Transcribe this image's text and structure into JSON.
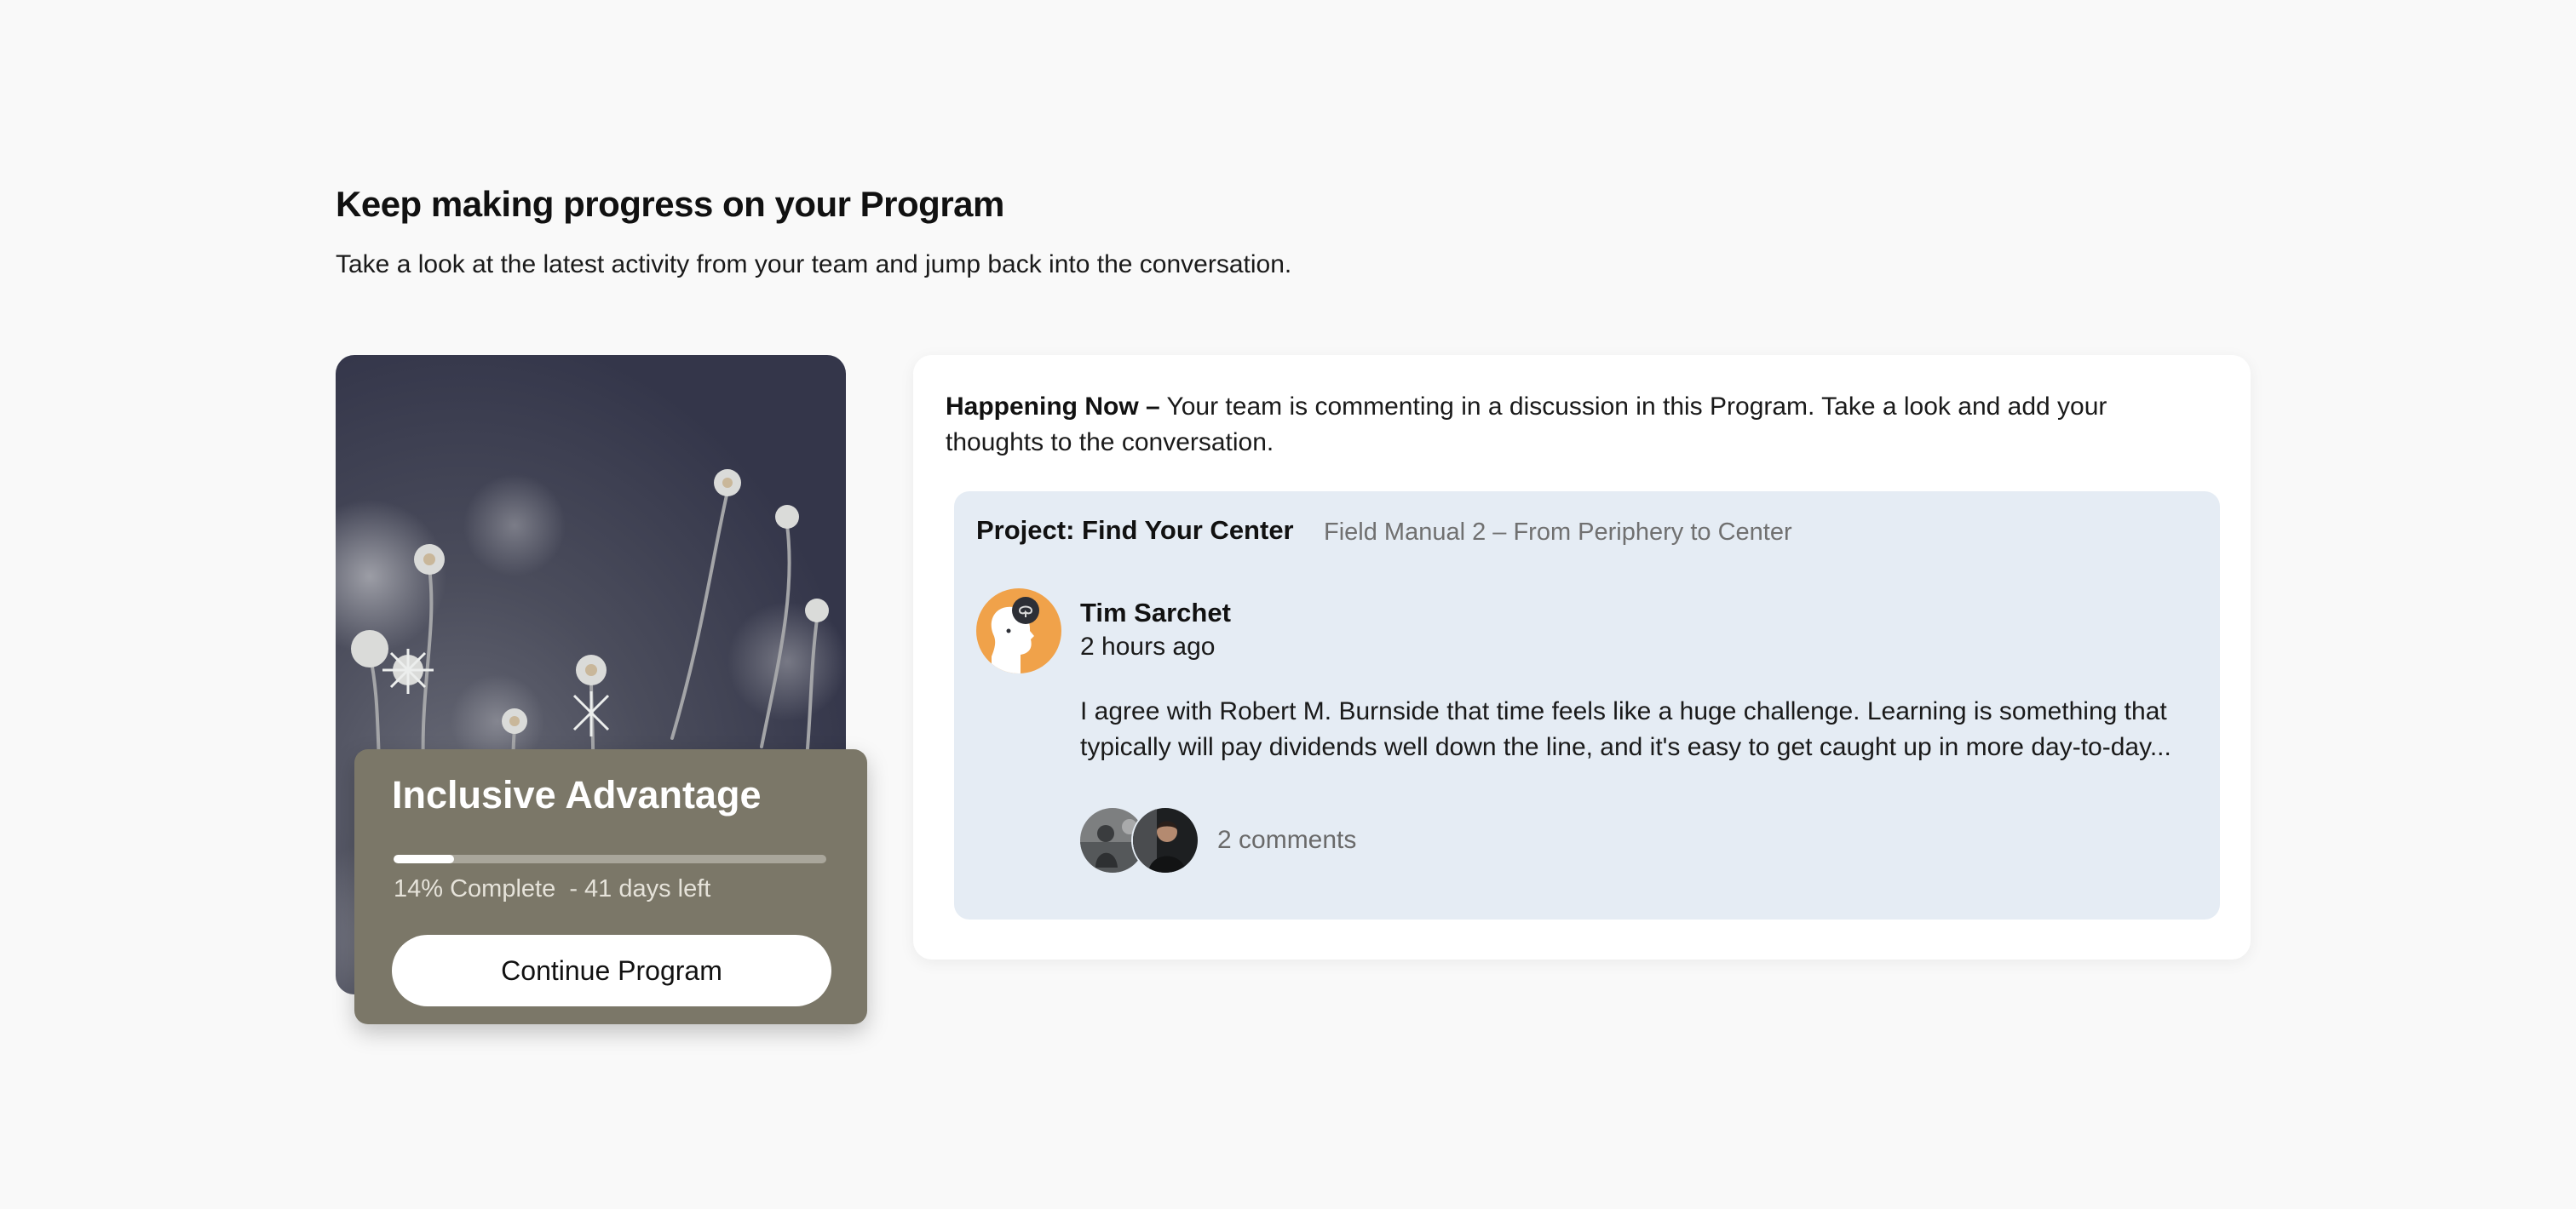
{
  "section": {
    "title": "Keep making progress on your Program",
    "subtitle": "Take a look at the latest activity from your team and jump back into the conversation."
  },
  "program": {
    "title": "Inclusive Advantage",
    "progress_fraction": 0.14,
    "progress_text": "14% Complete  - 41 days left",
    "continue_label": "Continue Program",
    "image_icon": "flowers-photo"
  },
  "activity": {
    "lead": "Happening Now –",
    "message": " Your team is commenting in a discussion in this Program. Take a look and add your thoughts to the conversation.",
    "project_title": "Project: Find Your Center",
    "project_subtitle": "Field Manual 2 – From Periphery to Center",
    "post": {
      "author": "Tim Sarchet",
      "time": "2 hours ago",
      "body": "I agree with Robert M. Burnside that time feels like a huge challenge. Learning is something that typically will pay dividends well down the line, and it's easy to get caught up in more day-to-day...",
      "avatar_icon": "head-silhouette-avatar"
    },
    "comments": {
      "label": "2 comments",
      "avatar_icons": [
        "commenter-photo-1",
        "commenter-photo-2"
      ]
    }
  },
  "colors": {
    "page_background": "#f9f9f9",
    "panel": "#7b7768",
    "discussion_background": "#e5ecf4",
    "avatar_orange": "#f0a24a"
  }
}
